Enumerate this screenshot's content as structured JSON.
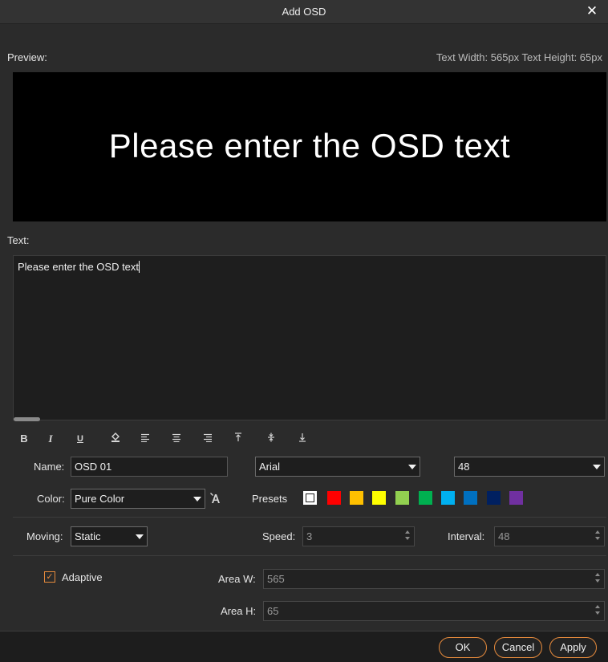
{
  "dialog": {
    "title": "Add OSD",
    "close_icon": "close-icon"
  },
  "preview": {
    "label": "Preview:",
    "size_info": "Text Width: 565px Text Height: 65px",
    "text": "Please enter the OSD text",
    "background": "#000000"
  },
  "text_section": {
    "label": "Text:",
    "value": "Please enter the OSD text"
  },
  "toolbar": {
    "bold": "B",
    "italic": "I",
    "underline": "U",
    "fill_icon": "paint-bucket-icon",
    "align_left_icon": "align-left-icon",
    "align_center_icon": "align-center-icon",
    "align_right_icon": "align-right-icon",
    "valign_top_icon": "align-top-icon",
    "valign_middle_icon": "align-middle-icon",
    "valign_bottom_icon": "align-bottom-icon"
  },
  "name": {
    "label": "Name:",
    "value": "OSD 01"
  },
  "font": {
    "value": "Arial"
  },
  "font_size": {
    "value": "48"
  },
  "color": {
    "label": "Color:",
    "value": "Pure Color",
    "picker_icon": "text-color-icon"
  },
  "presets": {
    "label": "Presets",
    "colors": [
      "#ffffff",
      "#ff0000",
      "#ffc000",
      "#ffff00",
      "#92d050",
      "#00b050",
      "#00b0f0",
      "#0070c0",
      "#002060",
      "#7030a0"
    ]
  },
  "moving": {
    "label": "Moving:",
    "value": "Static"
  },
  "speed": {
    "label": "Speed:",
    "value": "3"
  },
  "interval": {
    "label": "Interval:",
    "value": "48"
  },
  "adaptive": {
    "label": "Adaptive",
    "checked": true
  },
  "area_w": {
    "label": "Area W:",
    "value": "565"
  },
  "area_h": {
    "label": "Area H:",
    "value": "65"
  },
  "buttons": {
    "ok": "OK",
    "cancel": "Cancel",
    "apply": "Apply"
  },
  "accent_color": "#e58a3c"
}
